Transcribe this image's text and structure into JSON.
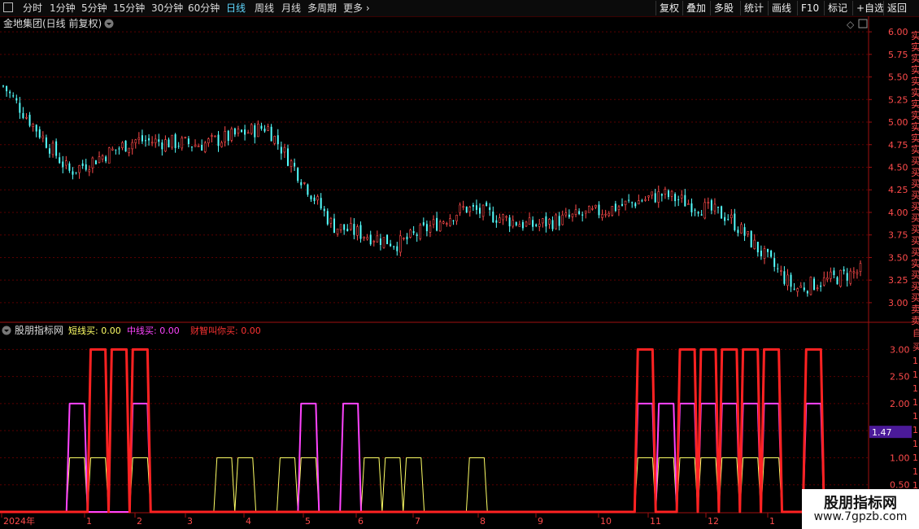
{
  "toolbar": {
    "periods": [
      "分时",
      "1分钟",
      "5分钟",
      "15分钟",
      "30分钟",
      "60分钟",
      "日线",
      "周线",
      "月线",
      "多周期",
      "更多"
    ],
    "active_period": "日线",
    "more_chevron": "›",
    "buttons": [
      "复权",
      "叠加",
      "多股",
      "统计",
      "画线",
      "F10",
      "标记",
      "+自选",
      "返回"
    ]
  },
  "main_chart": {
    "title": "金地集团(日线 前复权)",
    "diamond_icon": "◇",
    "yaxis_ticks": [
      "6.00",
      "5.75",
      "5.50",
      "5.25",
      "5.00",
      "4.75",
      "4.50",
      "4.25",
      "4.00",
      "3.75",
      "3.50",
      "3.25",
      "3.00"
    ],
    "right_edge_chars": [
      "实",
      "实",
      "实",
      "实",
      "实",
      "实",
      "实",
      "实",
      "实",
      "实",
      "实",
      "买",
      "买",
      "买",
      "买",
      "买",
      "买",
      "买",
      "买",
      "买",
      "实",
      "买",
      "买",
      "买",
      "卖",
      "卖",
      "卖",
      "卖",
      "卖",
      "卖",
      "卖",
      "卖",
      "卖",
      "卖",
      "卖",
      "卖",
      "卖",
      "卖",
      "卖",
      "卖",
      "卖",
      "卖",
      "卖",
      "卖",
      "卖",
      "卖"
    ]
  },
  "indicator": {
    "name": "股朋指标网",
    "labels": [
      {
        "text": "短线买: 0.00",
        "color": "#ffff66"
      },
      {
        "text": "中线买: 0.00",
        "color": "#ff44ff"
      },
      {
        "text": "财智叫你买: 0.00",
        "color": "#ff3333"
      }
    ],
    "yaxis_ticks": [
      "3.00",
      "2.50",
      "2.00",
      "1.50",
      "1.00",
      "0.50"
    ],
    "current_value": "1.47"
  },
  "xaxis": {
    "labels": [
      "2024年",
      "1",
      "2",
      "3",
      "4",
      "5",
      "6",
      "7",
      "8",
      "9",
      "10",
      "11",
      "12",
      "1"
    ]
  },
  "watermark": {
    "title": "股朋指标网",
    "url": "www.7gpzb.com"
  },
  "colors": {
    "up": "#ff4b4b",
    "down": "#54ffff",
    "grid": "#5a0000",
    "axis": "#a01010",
    "short_line": "#ffff66",
    "mid_line": "#ff44ff",
    "main_line": "#ff2222",
    "value_badge": "#4b1a99"
  },
  "chart_data": [
    {
      "type": "candlestick",
      "title": "金地集团(日线 前复权)",
      "ylim": [
        2.9,
        6.1
      ],
      "y_ticks": [
        3.0,
        3.25,
        3.5,
        3.75,
        4.0,
        4.25,
        4.5,
        4.75,
        5.0,
        5.25,
        5.5,
        5.75,
        6.0
      ],
      "close_trend": [
        {
          "month": "2023-12",
          "close": 5.4
        },
        {
          "month": "2024-01",
          "close": 4.45
        },
        {
          "month": "2024-02",
          "close": 4.8
        },
        {
          "month": "2024-03",
          "close": 4.75
        },
        {
          "month": "2024-04",
          "close": 4.95
        },
        {
          "month": "2024-05",
          "close": 3.85
        },
        {
          "month": "2024-06",
          "close": 3.65
        },
        {
          "month": "2024-07",
          "close": 4.05
        },
        {
          "month": "2024-08",
          "close": 3.85
        },
        {
          "month": "2024-09",
          "close": 4.0
        },
        {
          "month": "2024-10",
          "close": 4.2
        },
        {
          "month": "2024-11",
          "close": 3.95
        },
        {
          "month": "2024-12",
          "close": 3.15
        },
        {
          "month": "2025-01",
          "close": 3.35
        }
      ]
    },
    {
      "type": "line",
      "title": "股朋指标网",
      "ylim": [
        0,
        3.2
      ],
      "series": [
        {
          "name": "短线买",
          "values": [
            0,
            0,
            1,
            1,
            0,
            1,
            0,
            0,
            0,
            1,
            1,
            0,
            1,
            1,
            0,
            0,
            1,
            1,
            1,
            0,
            0,
            1,
            0,
            0,
            0,
            0,
            0,
            0,
            0,
            1,
            1,
            1,
            1,
            1,
            1,
            1,
            0,
            0,
            0,
            0
          ]
        },
        {
          "name": "中线买",
          "values": [
            0,
            0,
            2,
            0,
            0,
            2,
            0,
            0,
            0,
            0,
            0,
            0,
            0,
            2,
            0,
            2,
            0,
            0,
            0,
            0,
            0,
            0,
            0,
            0,
            0,
            0,
            0,
            0,
            0,
            2,
            2,
            2,
            2,
            2,
            2,
            2,
            0,
            2,
            0,
            0
          ]
        },
        {
          "name": "财智叫你买",
          "values": [
            0,
            0,
            0,
            3,
            3,
            3,
            0,
            0,
            0,
            0,
            0,
            0,
            0,
            0,
            0,
            0,
            0,
            0,
            0,
            0,
            0,
            0,
            0,
            0,
            0,
            0,
            0,
            0,
            0,
            3,
            0,
            3,
            3,
            3,
            3,
            3,
            0,
            3,
            0,
            0
          ]
        }
      ]
    }
  ]
}
